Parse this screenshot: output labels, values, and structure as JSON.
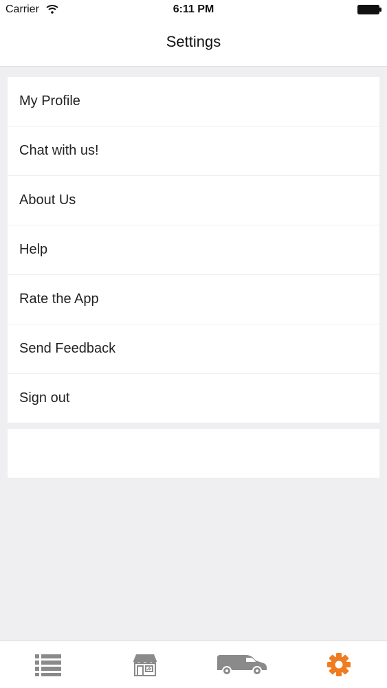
{
  "status_bar": {
    "carrier": "Carrier",
    "time": "6:11 PM"
  },
  "nav": {
    "title": "Settings"
  },
  "menu": {
    "items": [
      {
        "label": "My Profile"
      },
      {
        "label": "Chat with us!"
      },
      {
        "label": "About Us"
      },
      {
        "label": "Help"
      },
      {
        "label": "Rate the App"
      },
      {
        "label": "Send Feedback"
      },
      {
        "label": "Sign out"
      }
    ]
  },
  "tab_bar": {
    "tabs": [
      {
        "icon": "list-icon",
        "active": false
      },
      {
        "icon": "store-icon",
        "active": false
      },
      {
        "icon": "delivery-van-icon",
        "active": false
      },
      {
        "icon": "gear-icon",
        "active": true
      }
    ]
  },
  "colors": {
    "accent": "#f07c21",
    "tab_icon": "#8a8a8a",
    "background": "#efeff1",
    "card": "#ffffff"
  }
}
